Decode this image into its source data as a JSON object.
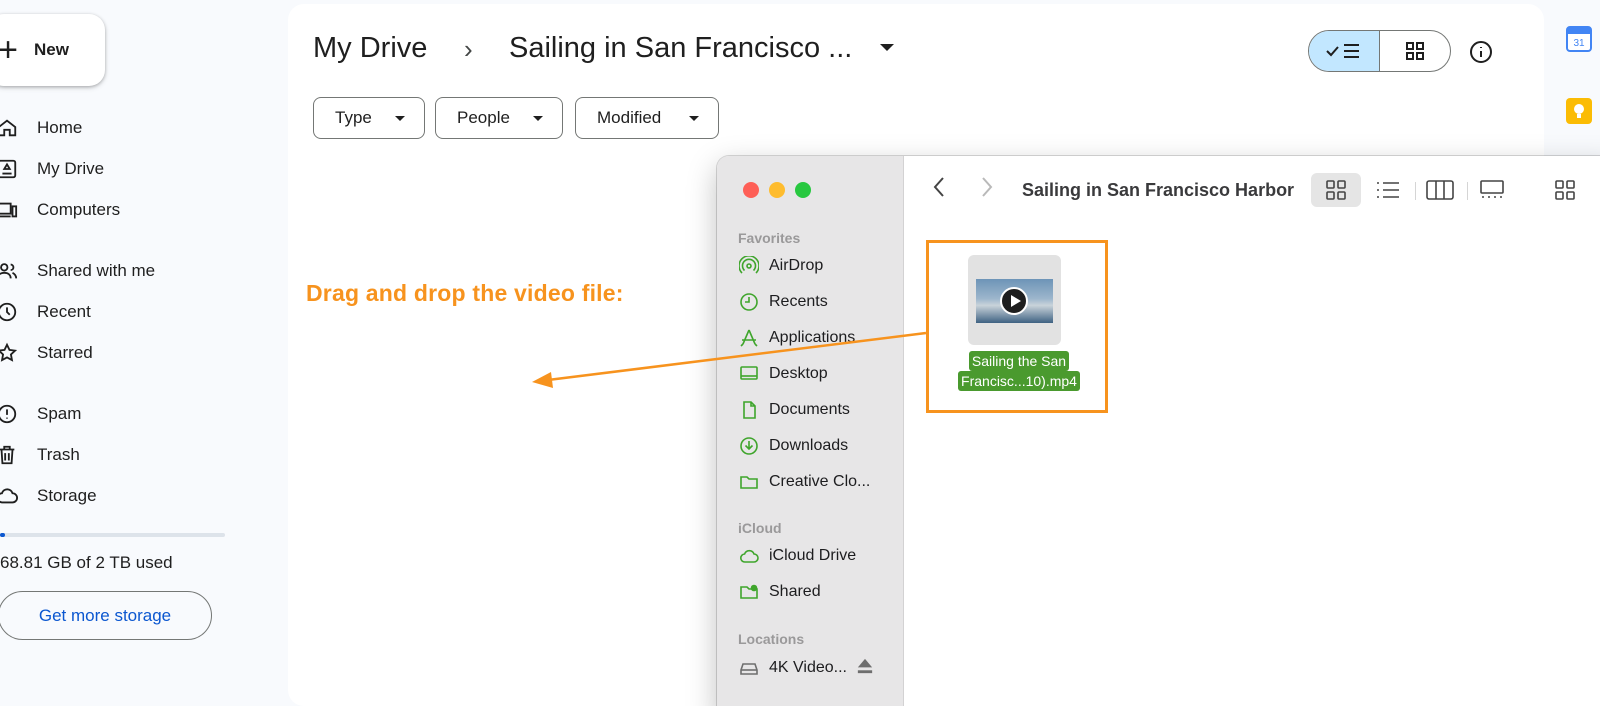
{
  "sidebar": {
    "new_label": "New",
    "items": [
      {
        "label": "Home",
        "icon": "home-icon"
      },
      {
        "label": "My Drive",
        "icon": "drive-icon"
      },
      {
        "label": "Computers",
        "icon": "computers-icon"
      },
      {
        "label": "Shared with me",
        "icon": "people-icon"
      },
      {
        "label": "Recent",
        "icon": "clock-icon"
      },
      {
        "label": "Starred",
        "icon": "star-icon"
      },
      {
        "label": "Spam",
        "icon": "spam-icon"
      },
      {
        "label": "Trash",
        "icon": "trash-icon"
      },
      {
        "label": "Storage",
        "icon": "cloud-icon"
      }
    ],
    "storage_used_fraction": 0.02,
    "storage_text": "68.81 GB of 2 TB used",
    "get_more_storage": "Get more storage"
  },
  "header": {
    "root": "My Drive",
    "separator": "›",
    "current": "Sailing in San Francisco ..."
  },
  "filters": [
    "Type",
    "People",
    "Modified"
  ],
  "instruction": "Drag and drop the video file:",
  "colors": {
    "accent": "#f7931e",
    "drive_blue": "#0b57d0",
    "toggle_on": "#c2e7ff",
    "finder_green": "#4a9a2e"
  },
  "finder": {
    "title": "Sailing in San Francisco Harbor",
    "sections": {
      "favorites": "Favorites",
      "icloud": "iCloud",
      "locations": "Locations"
    },
    "favorites": [
      "AirDrop",
      "Recents",
      "Applications",
      "Desktop",
      "Documents",
      "Downloads",
      "Creative Clo..."
    ],
    "icloud": [
      "iCloud Drive",
      "Shared"
    ],
    "locations": [
      "4K Video..."
    ],
    "file": {
      "name_line1": "Sailing the San",
      "name_line2": "Francisc...10).mp4"
    }
  }
}
